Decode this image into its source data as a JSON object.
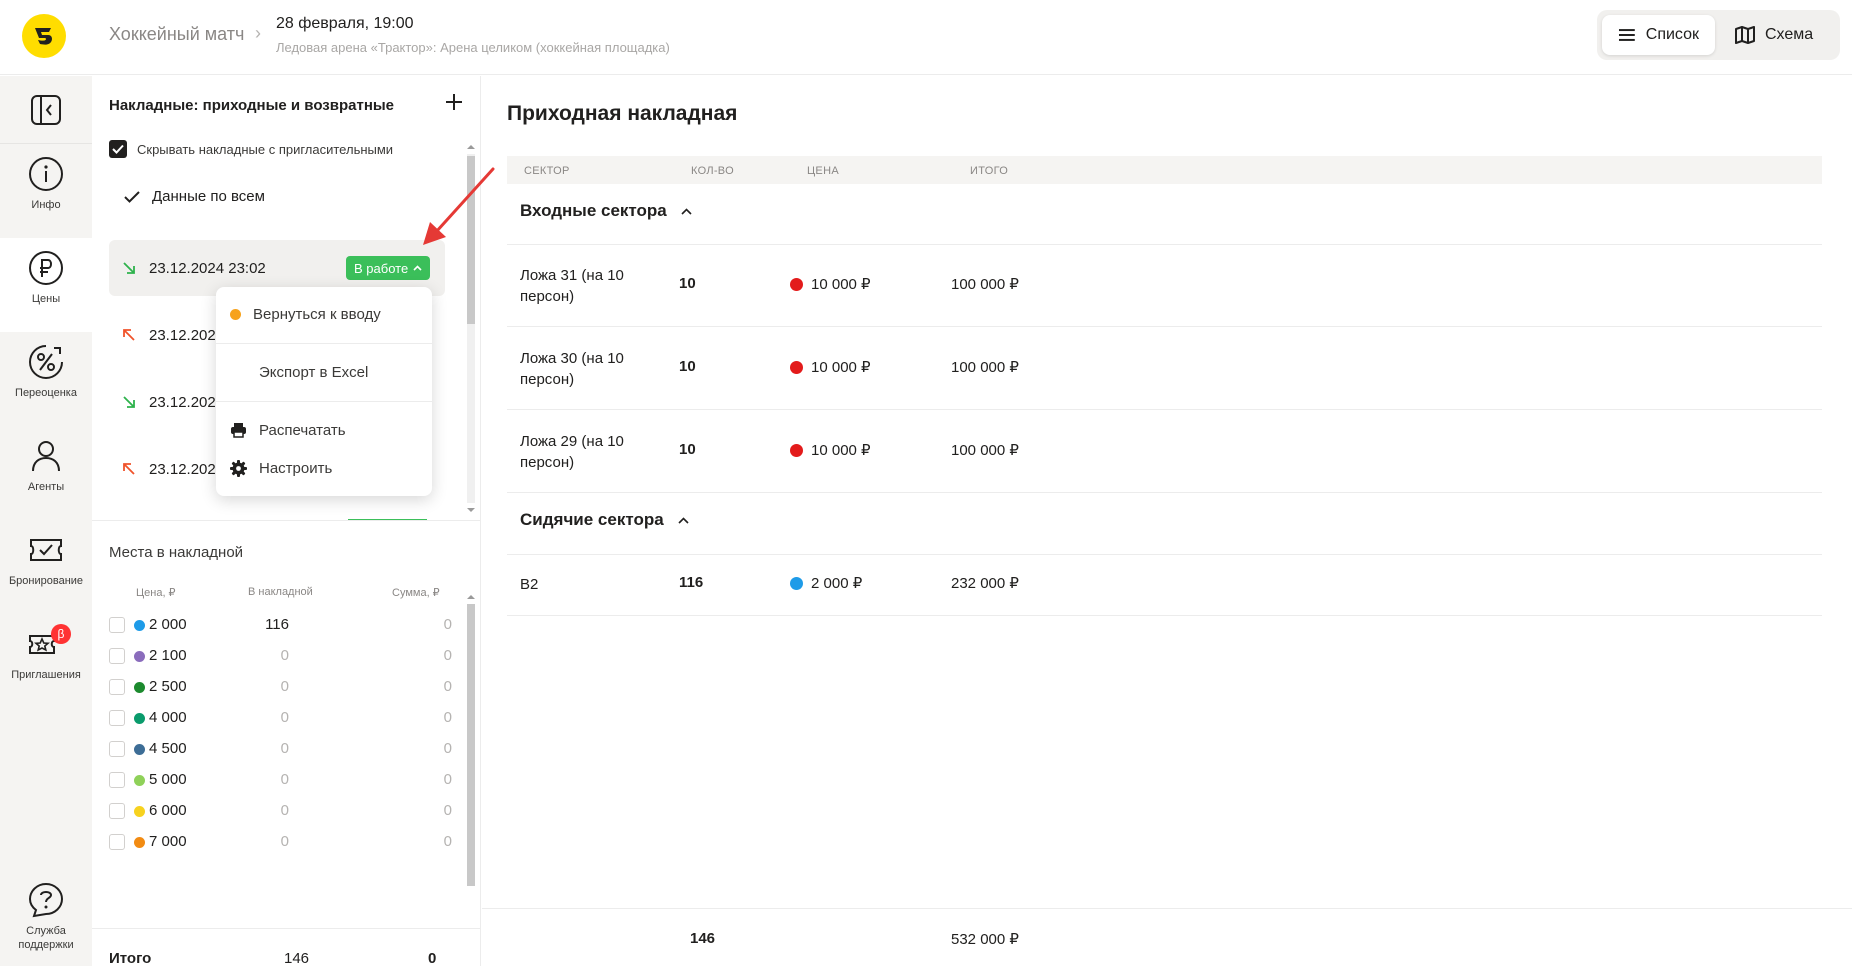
{
  "header": {
    "event": "Хоккейный матч",
    "separator": "›",
    "date": "28 февраля, 19:00",
    "venue": "Ледовая арена «Трактор»: Арена целиком (хоккейная площадка)",
    "view_list": "Список",
    "view_map": "Схема"
  },
  "nav": {
    "items": [
      {
        "label": "Инфо",
        "icon": "info-icon"
      },
      {
        "label": "Цены",
        "icon": "ruble-icon",
        "active": true
      },
      {
        "label": "Переоценка",
        "icon": "percent-icon"
      },
      {
        "label": "Агенты",
        "icon": "person-icon"
      },
      {
        "label": "Бронирование",
        "icon": "booking-icon"
      },
      {
        "label": "Приглашения",
        "icon": "ticket-star-icon",
        "badge": "β"
      }
    ],
    "support": "Служба поддержки"
  },
  "invoices": {
    "title": "Накладные: приходные и возвратные",
    "hide_label": "Скрывать накладные с пригласительными",
    "all_data": "Данные по всем",
    "rows": [
      {
        "date": "23.12.2024 23:02",
        "direction": "in",
        "status": "В работе",
        "selected": true
      },
      {
        "date": "23.12.2024",
        "direction": "out"
      },
      {
        "date": "23.12.2024",
        "direction": "in"
      },
      {
        "date": "23.12.2024",
        "direction": "out"
      }
    ]
  },
  "menu": {
    "back_to_input": "Вернуться к вводу",
    "export_excel": "Экспорт в Excel",
    "print": "Распечатать",
    "configure": "Настроить"
  },
  "seats": {
    "title": "Места в накладной",
    "col_price": "Цена, ₽",
    "col_in_invoice": "В накладной",
    "col_sum": "Сумма, ₽",
    "rows": [
      {
        "price": "2 000",
        "color": "#1e9be8",
        "qty": "116",
        "sum": "0"
      },
      {
        "price": "2 100",
        "color": "#8a6cbc",
        "qty": "0",
        "sum": "0"
      },
      {
        "price": "2 500",
        "color": "#1c8a2e",
        "qty": "0",
        "sum": "0"
      },
      {
        "price": "4 000",
        "color": "#0a9b6c",
        "qty": "0",
        "sum": "0"
      },
      {
        "price": "4 500",
        "color": "#3d6d96",
        "qty": "0",
        "sum": "0"
      },
      {
        "price": "5 000",
        "color": "#8fd159",
        "qty": "0",
        "sum": "0"
      },
      {
        "price": "6 000",
        "color": "#f7d21f",
        "qty": "0",
        "sum": "0"
      },
      {
        "price": "7 000",
        "color": "#f28b12",
        "qty": "0",
        "sum": "0"
      }
    ],
    "total_label": "Итого",
    "total_qty": "146",
    "total_sum": "0"
  },
  "main": {
    "title": "Приходная накладная",
    "col_sector": "СЕКТОР",
    "col_qty": "КОЛ-ВО",
    "col_price": "ЦЕНА",
    "col_total": "ИТОГО",
    "groups": [
      {
        "name": "Входные сектора",
        "rows": [
          {
            "sector": "Ложа 31 (на 10 персон)",
            "qty": "10",
            "price": "10 000 ₽",
            "price_color": "#e31b1b",
            "total": "100 000 ₽"
          },
          {
            "sector": "Ложа 30 (на 10 персон)",
            "qty": "10",
            "price": "10 000 ₽",
            "price_color": "#e31b1b",
            "total": "100 000 ₽"
          },
          {
            "sector": "Ложа 29 (на 10 персон)",
            "qty": "10",
            "price": "10 000 ₽",
            "price_color": "#e31b1b",
            "total": "100 000 ₽"
          }
        ]
      },
      {
        "name": "Сидячие сектора",
        "rows": [
          {
            "sector": "B2",
            "qty": "116",
            "price": "2 000 ₽",
            "price_color": "#1e9be8",
            "total": "232 000 ₽"
          }
        ]
      }
    ],
    "footer_qty": "146",
    "footer_total": "532 000 ₽"
  },
  "colors": {
    "accent_yellow": "#ffdd00",
    "status_green": "#3bbf5a",
    "arrow_in": "#2eb24c",
    "arrow_out": "#f0532b",
    "annotation_red": "#e53935",
    "menu_orange_dot": "#f7a21b"
  }
}
